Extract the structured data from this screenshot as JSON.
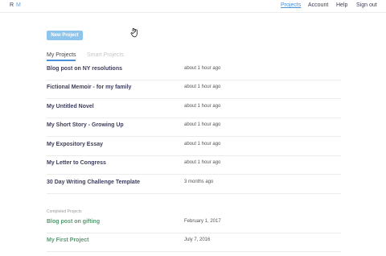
{
  "logo": {
    "r": "R",
    "m": "M"
  },
  "nav": {
    "projects": "Projects",
    "account": "Account",
    "help": "Help",
    "signout": "Sign out"
  },
  "new_project_label": "New Project",
  "tabs": {
    "my_projects": "My Projects",
    "smart_projects": "Smart Projects"
  },
  "projects": [
    {
      "title": "Blog post on NY resolutions",
      "time": "about 1 hour ago"
    },
    {
      "title": "Fictional Memoir - for my family",
      "time": "about 1 hour ago"
    },
    {
      "title": "My Untitled Novel",
      "time": "about 1 hour ago"
    },
    {
      "title": "My Short Story - Growing Up",
      "time": "about 1 hour ago"
    },
    {
      "title": "My Expository Essay",
      "time": "about 1 hour ago"
    },
    {
      "title": "My Letter to Congress",
      "time": "about 1 hour ago"
    },
    {
      "title": "30 Day Writing Challenge Template",
      "time": "3 months ago"
    }
  ],
  "completed_label": "Completed Projects",
  "completed": [
    {
      "title": "Blog post on gifting",
      "time": "February 1, 2017"
    },
    {
      "title": "My First Project",
      "time": "July 7, 2016"
    }
  ],
  "colors": {
    "accent": "#4a90d9",
    "button": "#8ec5ec",
    "title": "#3d3d5c",
    "completed_title": "#5a9a72"
  }
}
